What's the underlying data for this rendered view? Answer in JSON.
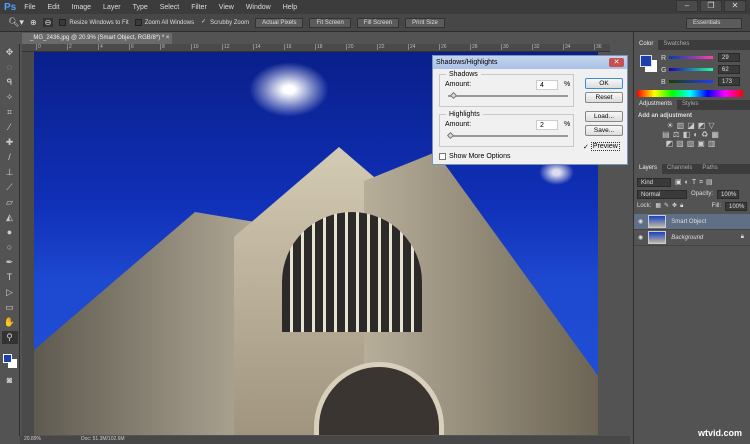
{
  "app": {
    "logo": "Ps",
    "menu": [
      "File",
      "Edit",
      "Image",
      "Layer",
      "Type",
      "Select",
      "Filter",
      "View",
      "Window",
      "Help"
    ]
  },
  "options": {
    "resize_windows": "Resize Windows to Fit",
    "zoom_all": "Zoom All Windows",
    "scrubby": "Scrubby Zoom",
    "actual_pixels": "Actual Pixels",
    "fit_screen": "Fit Screen",
    "fill_screen": "Fill Screen",
    "print_size": "Print Size",
    "workspace": "Essentials"
  },
  "document": {
    "tab": "_MG_2436.jpg @ 20.9% (Smart Object, RGB/8*) *",
    "ruler": [
      "0",
      "2",
      "4",
      "6",
      "8",
      "10",
      "12",
      "14",
      "16",
      "18",
      "20",
      "22",
      "24",
      "26",
      "28",
      "30",
      "32",
      "34",
      "36"
    ],
    "zoom": "20.89%",
    "doc_size": "Doc: 51.3M/102.6M"
  },
  "dialog": {
    "title": "Shadows/Highlights",
    "shadows_label": "Shadows",
    "amount_label": "Amount:",
    "shadows_amount": "4",
    "highlights_label": "Highlights",
    "highlights_amount": "2",
    "percent": "%",
    "ok": "OK",
    "reset": "Reset",
    "load": "Load...",
    "save": "Save...",
    "preview": "Preview",
    "show_more": "Show More Options",
    "shadows_fraction": 0.04,
    "highlights_fraction": 0.02
  },
  "color_panel": {
    "tabs": [
      "Color",
      "Swatches"
    ],
    "r_label": "R",
    "g_label": "G",
    "b_label": "B",
    "r": "29",
    "g": "62",
    "b": "173",
    "foreground": "#1d3ead"
  },
  "adjustments": {
    "tabs": [
      "Adjustments",
      "Styles"
    ],
    "heading": "Add an adjustment"
  },
  "layers": {
    "tabs": [
      "Layers",
      "Channels",
      "Paths"
    ],
    "kind": "Kind",
    "blend": "Normal",
    "opacity_label": "Opacity:",
    "opacity": "100%",
    "lock_label": "Lock:",
    "fill_label": "Fill:",
    "fill": "100%",
    "items": [
      {
        "name": "Smart Object"
      },
      {
        "name": "Background"
      }
    ]
  },
  "watermark": "wtvid.com"
}
